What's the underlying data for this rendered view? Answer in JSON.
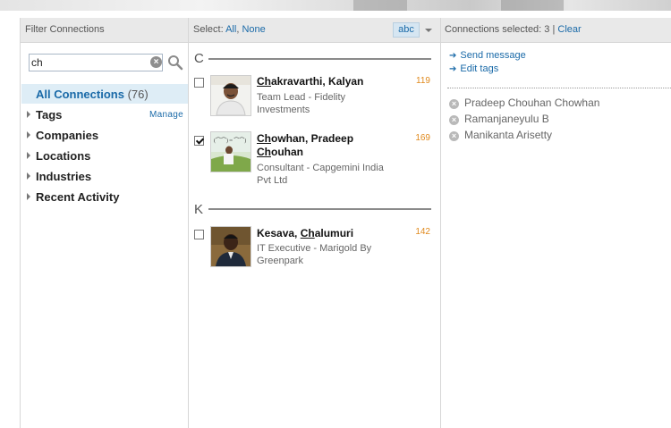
{
  "header": {
    "filter_title": "Filter Connections",
    "select_label": "Select:",
    "select_all": "All",
    "select_sep": ",",
    "select_none": "None",
    "sort_label": "abc",
    "connections_selected_label": "Connections selected: 3 |",
    "clear_label": "Clear"
  },
  "search": {
    "value": "ch",
    "placeholder": ""
  },
  "filters": {
    "all_connections": "All Connections",
    "all_count": "(76)",
    "items": [
      "Tags",
      "Companies",
      "Locations",
      "Industries",
      "Recent Activity"
    ],
    "manage_label": "Manage"
  },
  "groups": [
    {
      "letter": "C",
      "people": [
        {
          "name_pre": "",
          "name_u": "Ch",
          "name_post": "akravarthi, Kalyan",
          "line2_u": "",
          "line2_post": "",
          "desc": "Team Lead - Fidelity Investments",
          "count": "119",
          "checked": false
        },
        {
          "name_pre": "",
          "name_u": "Ch",
          "name_post": "owhan, Pradeep",
          "line2_u": "Ch",
          "line2_post": "ouhan",
          "desc": "Consultant - Capgemini India Pvt Ltd",
          "count": "169",
          "checked": true
        }
      ]
    },
    {
      "letter": "K",
      "people": [
        {
          "name_pre": "Kesava, ",
          "name_u": "Ch",
          "name_post": "alumuri",
          "line2_u": "",
          "line2_post": "",
          "desc": "IT Executive - Marigold By Greenpark",
          "count": "142",
          "checked": false
        }
      ]
    }
  ],
  "actions": {
    "send_message": "Send message",
    "edit_tags": "Edit tags"
  },
  "selected": [
    "Pradeep Chouhan Chowhan",
    "Ramanjaneyulu B",
    "Manikanta Arisetty"
  ],
  "colors": {
    "link": "#1a6aa8",
    "count": "#e08a1e",
    "header_bg": "#e9e9e9",
    "highlight_bg": "#deedf6"
  }
}
